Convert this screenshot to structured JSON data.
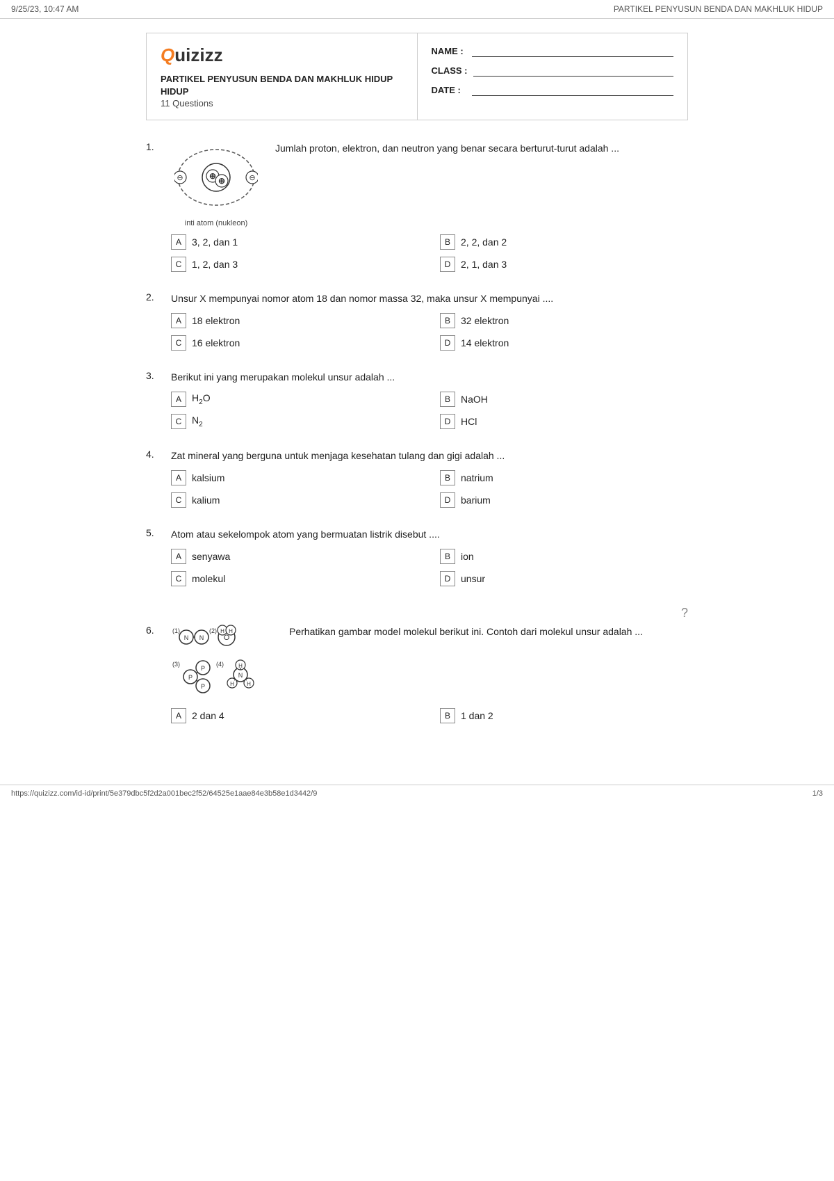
{
  "topBar": {
    "datetime": "9/25/23, 10:47 AM",
    "title": "PARTIKEL PENYUSUN BENDA DAN MAKHLUK HIDUP"
  },
  "header": {
    "logo": "Quizizz",
    "quizTitle": "PARTIKEL PENYUSUN BENDA DAN MAKHLUK HIDUP",
    "quizSubtitle": "HIDUP",
    "questionsCount": "11 Questions",
    "nameLabel": "NAME :",
    "classLabel": "CLASS :",
    "dateLabel": "DATE  :"
  },
  "questions": [
    {
      "number": "1.",
      "text": "Jumlah proton, elektron, dan neutron yang benar secara berturut-turut adalah ...",
      "hasImage": true,
      "imageCaption": "inti atom (nukleon)",
      "options": [
        {
          "letter": "A",
          "text": "3, 2, dan 1"
        },
        {
          "letter": "B",
          "text": "2, 2, dan 2"
        },
        {
          "letter": "C",
          "text": "1, 2, dan 3"
        },
        {
          "letter": "D",
          "text": "2, 1, dan 3"
        }
      ]
    },
    {
      "number": "2.",
      "text": "Unsur X mempunyai nomor atom 18 dan nomor massa 32, maka unsur X mempunyai ....",
      "hasImage": false,
      "options": [
        {
          "letter": "A",
          "text": "18 elektron"
        },
        {
          "letter": "B",
          "text": "32 elektron"
        },
        {
          "letter": "C",
          "text": "16 elektron"
        },
        {
          "letter": "D",
          "text": "14 elektron"
        }
      ]
    },
    {
      "number": "3.",
      "text": "Berikut ini yang merupakan molekul unsur adalah ...",
      "hasImage": false,
      "options": [
        {
          "letter": "A",
          "text": "H₂O"
        },
        {
          "letter": "B",
          "text": "NaOH"
        },
        {
          "letter": "C",
          "text": "N₂"
        },
        {
          "letter": "D",
          "text": "HCl"
        }
      ]
    },
    {
      "number": "4.",
      "text": "Zat mineral yang berguna untuk menjaga kesehatan tulang dan gigi adalah ...",
      "hasImage": false,
      "options": [
        {
          "letter": "A",
          "text": "kalsium"
        },
        {
          "letter": "B",
          "text": "natrium"
        },
        {
          "letter": "C",
          "text": "kalium"
        },
        {
          "letter": "D",
          "text": "barium"
        }
      ]
    },
    {
      "number": "5.",
      "text": "Atom atau sekelompok atom yang bermuatan listrik disebut ....",
      "hasImage": false,
      "options": [
        {
          "letter": "A",
          "text": "senyawa"
        },
        {
          "letter": "B",
          "text": "ion"
        },
        {
          "letter": "C",
          "text": "molekul"
        },
        {
          "letter": "D",
          "text": "unsur"
        }
      ]
    },
    {
      "number": "6.",
      "text": "Perhatikan gambar model molekul berikut ini. Contoh dari molekul unsur adalah ...",
      "hasImage": true,
      "imageType": "molecule-model",
      "options": [
        {
          "letter": "A",
          "text": "2 dan 4"
        },
        {
          "letter": "B",
          "text": "1 dan 2"
        }
      ]
    }
  ],
  "bottomBar": {
    "url": "https://quizizz.com/id-id/print/5e379dbc5f2d2a001bec2f52/64525e1aae84e3b58e1d3442/9",
    "pageNum": "1/3"
  }
}
